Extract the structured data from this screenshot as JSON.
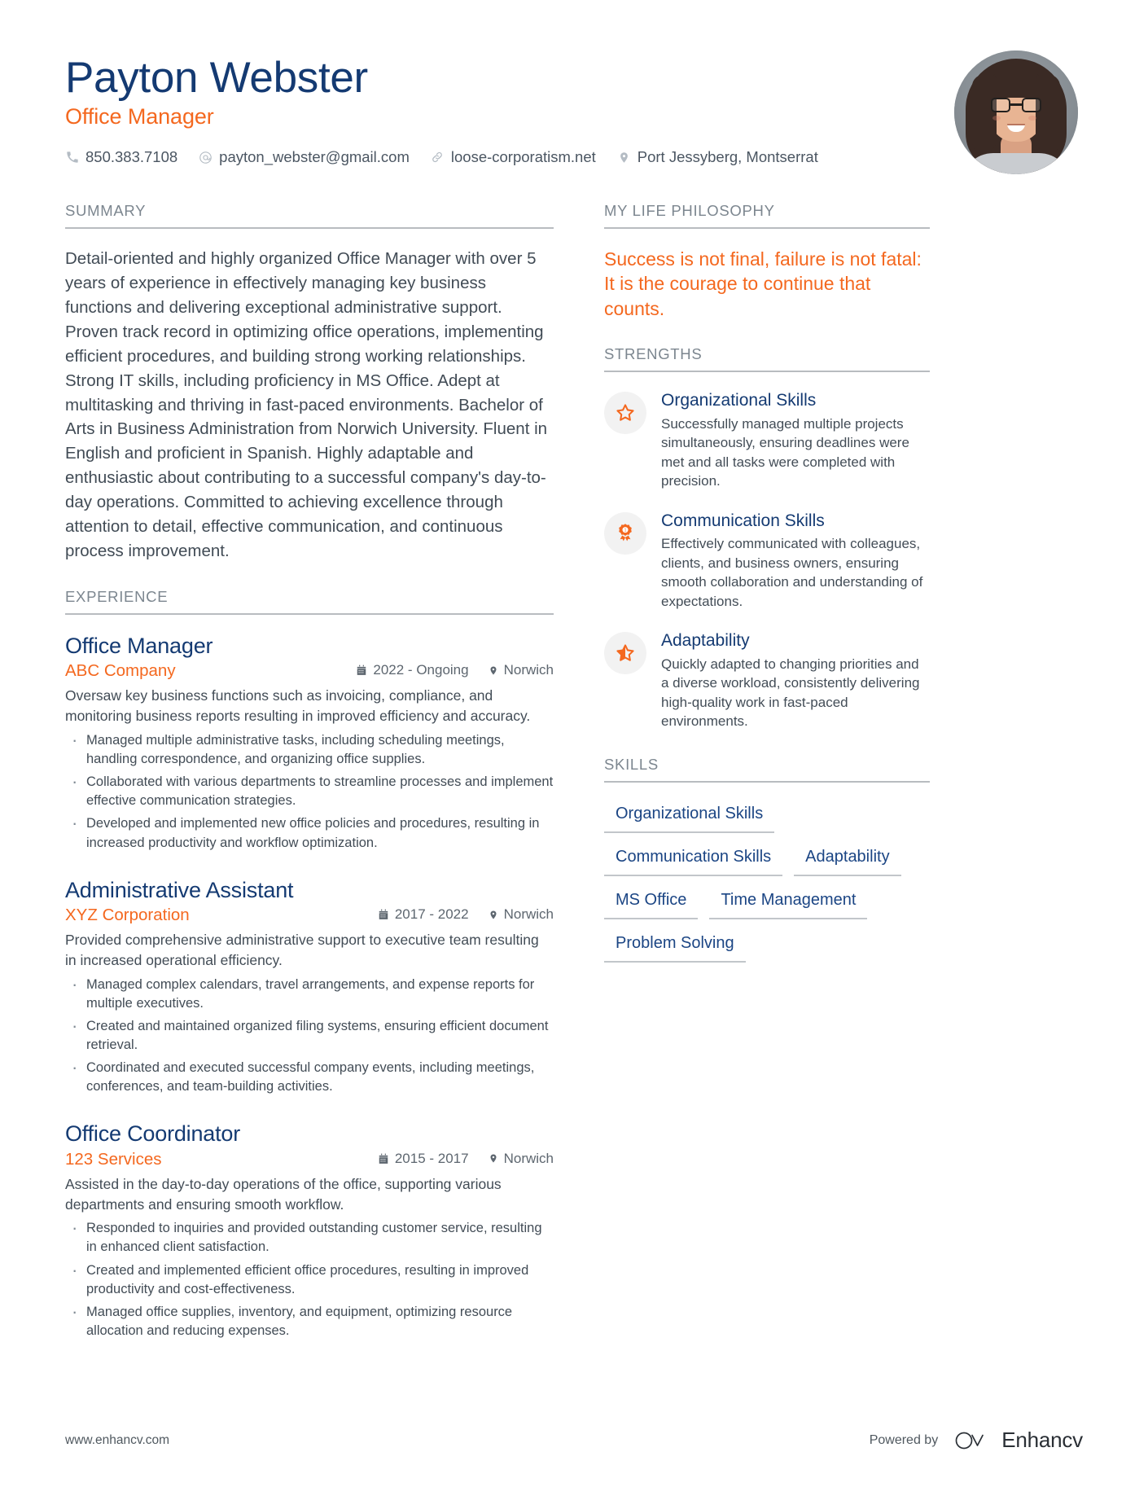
{
  "header": {
    "full_name": "Payton Webster",
    "job_title": "Office Manager",
    "contacts": [
      {
        "icon": "phone-icon",
        "value": "850.383.7108"
      },
      {
        "icon": "email-icon",
        "value": "payton_webster@gmail.com"
      },
      {
        "icon": "link-icon",
        "value": "loose-corporatism.net"
      },
      {
        "icon": "location-pin-icon",
        "value": "Port Jessyberg, Montserrat"
      }
    ],
    "avatar_alt": "profile-photo"
  },
  "summary": {
    "title": "SUMMARY",
    "text": "Detail-oriented and highly organized Office Manager with over 5 years of experience in effectively managing key business functions and delivering exceptional administrative support. Proven track record in optimizing office operations, implementing efficient procedures, and building strong working relationships. Strong IT skills, including proficiency in MS Office. Adept at multitasking and thriving in fast-paced environments. Bachelor of Arts in Business Administration from Norwich University. Fluent in English and proficient in Spanish. Highly adaptable and enthusiastic about contributing to a successful company's day-to-day operations. Committed to achieving excellence through attention to detail, effective communication, and continuous process improvement."
  },
  "experience": {
    "title": "EXPERIENCE",
    "jobs": [
      {
        "role": "Office Manager",
        "company": "ABC Company",
        "dates": "2022 - Ongoing",
        "location": "Norwich",
        "description": "Oversaw key business functions such as invoicing, compliance, and monitoring business reports resulting in improved efficiency and accuracy.",
        "bullets": [
          "Managed multiple administrative tasks, including scheduling meetings, handling correspondence, and organizing office supplies.",
          "Collaborated with various departments to streamline processes and implement effective communication strategies.",
          "Developed and implemented new office policies and procedures, resulting in increased productivity and workflow optimization."
        ]
      },
      {
        "role": "Administrative Assistant",
        "company": "XYZ Corporation",
        "dates": "2017 - 2022",
        "location": "Norwich",
        "description": "Provided comprehensive administrative support to executive team resulting in increased operational efficiency.",
        "bullets": [
          "Managed complex calendars, travel arrangements, and expense reports for multiple executives.",
          "Created and maintained organized filing systems, ensuring efficient document retrieval.",
          "Coordinated and executed successful company events, including meetings, conferences, and team-building activities."
        ]
      },
      {
        "role": "Office Coordinator",
        "company": "123 Services",
        "dates": "2015 - 2017",
        "location": "Norwich",
        "description": "Assisted in the day-to-day operations of the office, supporting various departments and ensuring smooth workflow.",
        "bullets": [
          "Responded to inquiries and provided outstanding customer service, resulting in enhanced client satisfaction.",
          "Created and implemented efficient office procedures, resulting in improved productivity and cost-effectiveness.",
          "Managed office supplies, inventory, and equipment, optimizing resource allocation and reducing expenses."
        ]
      }
    ]
  },
  "philosophy": {
    "title": "MY LIFE PHILOSOPHY",
    "quote": "Success is not final, failure is not fatal: It is the courage to continue that counts."
  },
  "strengths": {
    "title": "STRENGTHS",
    "items": [
      {
        "icon": "star-outline-icon",
        "name": "Organizational Skills",
        "description": "Successfully managed multiple projects simultaneously, ensuring deadlines were met and all tasks were completed with precision."
      },
      {
        "icon": "award-ribbon-icon",
        "name": "Communication Skills",
        "description": "Effectively communicated with colleagues, clients, and business owners, ensuring smooth collaboration and understanding of expectations."
      },
      {
        "icon": "star-half-filled-icon",
        "name": "Adaptability",
        "description": "Quickly adapted to changing priorities and a diverse workload, consistently delivering high-quality work in fast-paced environments."
      }
    ]
  },
  "skills": {
    "title": "SKILLS",
    "items": [
      "Organizational Skills",
      "Communication Skills",
      "Adaptability",
      "MS Office",
      "Time Management",
      "Problem Solving"
    ]
  },
  "footer": {
    "url": "www.enhancv.com",
    "powered_by": "Powered by",
    "brand": "Enhancv"
  },
  "colors": {
    "navy": "#143a72",
    "orange": "#f4681f",
    "body_text": "#414b55",
    "muted": "#7c868f",
    "rule": "#b8bcc0"
  }
}
